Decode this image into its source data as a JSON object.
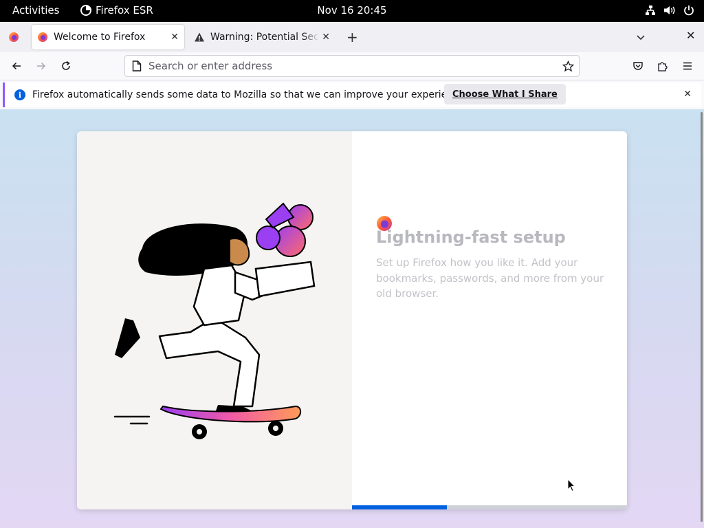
{
  "topbar": {
    "activities": "Activities",
    "app_name": "Firefox ESR",
    "clock": "Nov 16  20:45"
  },
  "tabs": [
    {
      "label": "Welcome to Firefox",
      "active": true,
      "icon": "firefox-icon"
    },
    {
      "label": "Warning: Potential Security Risk Ahead",
      "active": false,
      "icon": "warning-icon"
    }
  ],
  "urlbar": {
    "placeholder": "Search or enter address"
  },
  "notification": {
    "message": "Firefox automatically sends some data to Mozilla so that we can improve your experience.",
    "button_label": "Choose What I Share"
  },
  "onboarding": {
    "title": "Lightning-fast setup",
    "description": "Set up Firefox how you like it. Add your bookmarks, passwords, and more from your old browser.",
    "progress": 0.345
  },
  "colors": {
    "accent": "#0060df",
    "notification_border": "#9059ff",
    "page_bg_top": "#c9e1f1",
    "page_bg_bottom": "#e3d7f4"
  }
}
